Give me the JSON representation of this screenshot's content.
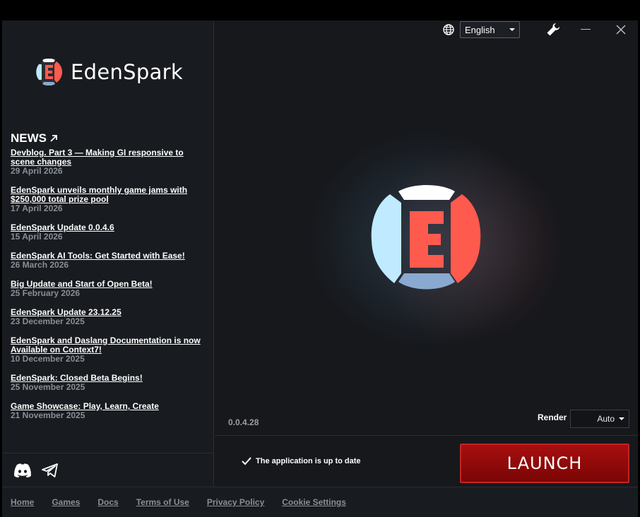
{
  "brand": {
    "name": "EdenSpark"
  },
  "news": {
    "title": "NEWS",
    "items": [
      {
        "title": "Devblog. Part 3 — Making GI responsive to scene changes",
        "date": "29 April 2026"
      },
      {
        "title": "EdenSpark unveils monthly game jams with $250,000 total prize pool",
        "date": "17 April 2026"
      },
      {
        "title": "EdenSpark Update 0.0.4.6",
        "date": "15 April 2026"
      },
      {
        "title": "EdenSpark AI Tools: Get Started with Ease!",
        "date": "26 March 2026"
      },
      {
        "title": "Big Update and Start of Open Beta!",
        "date": "25 February 2026"
      },
      {
        "title": "EdenSpark Update 23.12.25",
        "date": "23 December 2025"
      },
      {
        "title": "EdenSpark and Daslang Documentation is now Available on Context7!",
        "date": "10 December 2025"
      },
      {
        "title": "EdenSpark: Closed Beta Begins!",
        "date": "25 November 2025"
      },
      {
        "title": "Game Showcase: Play, Learn, Create",
        "date": "21 November 2025"
      }
    ]
  },
  "social": {
    "icons": [
      "discord-icon",
      "telegram-icon"
    ]
  },
  "topbar": {
    "language": "English",
    "icons": [
      "globe-icon",
      "wrench-icon",
      "minimize-icon",
      "close-icon"
    ]
  },
  "main": {
    "version": "0.0.4.28",
    "render_label": "Render",
    "render_value": "Auto",
    "status_text": "The application is up to date",
    "launch_label": "LAUNCH"
  },
  "footer": {
    "links": [
      "Home",
      "Games",
      "Docs",
      "Terms of Use",
      "Privacy Policy",
      "Cookie Settings"
    ]
  },
  "colors": {
    "accent_red": "#a60f0f",
    "logo_light_blue": "#bfeaff",
    "logo_red": "#ff5a4e",
    "logo_steel_blue": "#8aa9d0"
  }
}
